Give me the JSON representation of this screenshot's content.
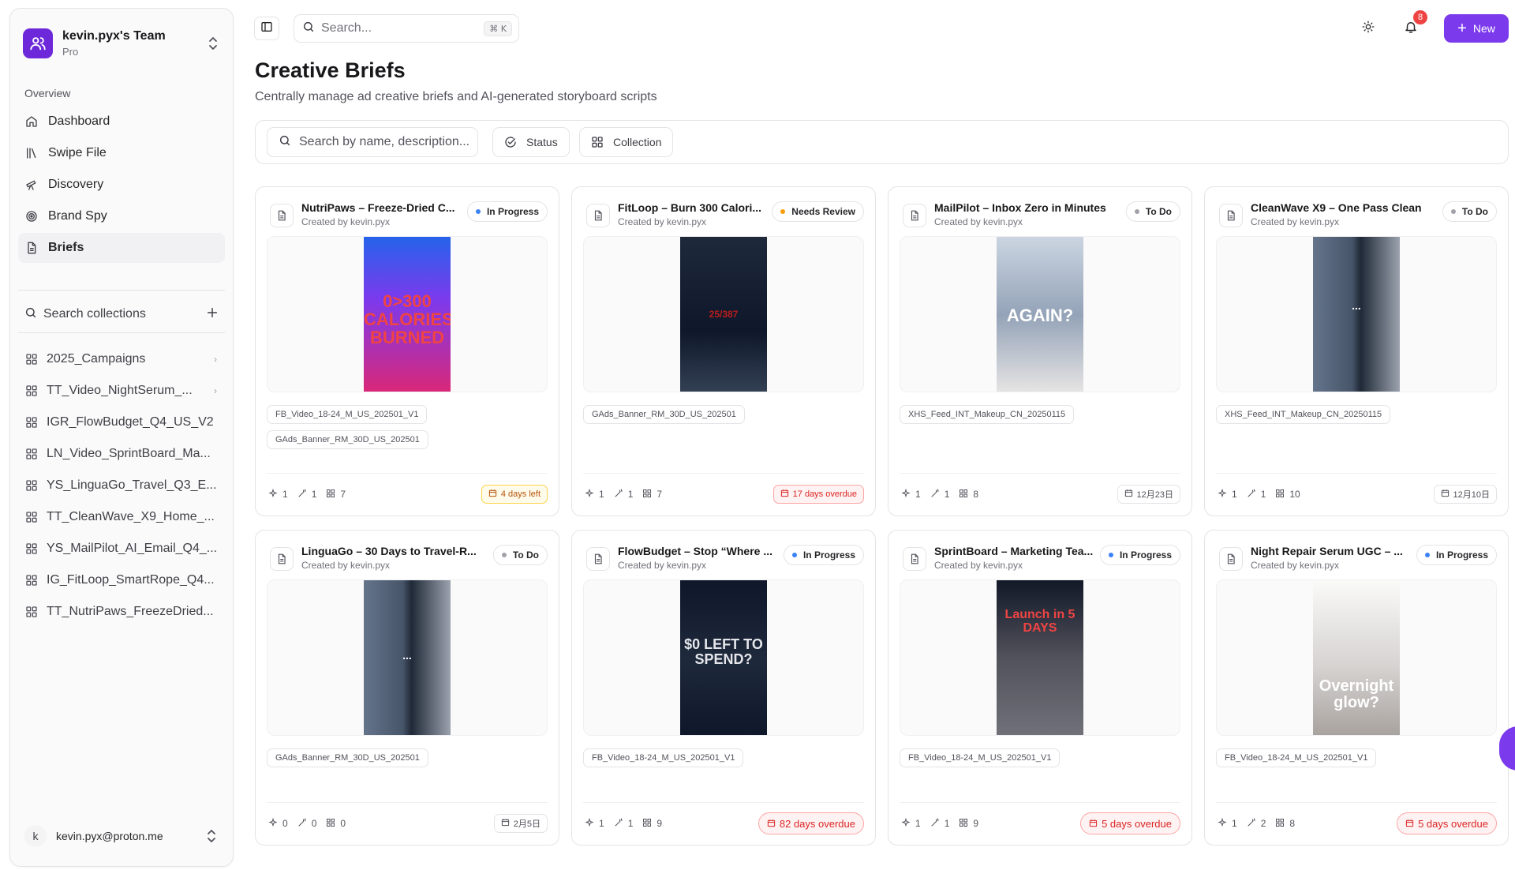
{
  "team": {
    "name": "kevin.pyx's Team",
    "plan": "Pro"
  },
  "nav": {
    "section": "Overview",
    "items": [
      {
        "label": "Dashboard",
        "icon": "home-icon"
      },
      {
        "label": "Swipe File",
        "icon": "library-icon"
      },
      {
        "label": "Discovery",
        "icon": "telescope-icon"
      },
      {
        "label": "Brand Spy",
        "icon": "target-icon"
      },
      {
        "label": "Briefs",
        "icon": "document-icon",
        "active": true
      }
    ]
  },
  "collections": {
    "search_label": "Search collections",
    "items": [
      {
        "label": "2025_Campaigns",
        "chevron": true
      },
      {
        "label": "TT_Video_NightSerum_...",
        "chevron": true
      },
      {
        "label": "IGR_FlowBudget_Q4_US_V2"
      },
      {
        "label": "LN_Video_SprintBoard_Ma..."
      },
      {
        "label": "YS_LinguaGo_Travel_Q3_E..."
      },
      {
        "label": "TT_CleanWave_X9_Home_..."
      },
      {
        "label": "YS_MailPilot_AI_Email_Q4_..."
      },
      {
        "label": "IG_FitLoop_SmartRope_Q4..."
      },
      {
        "label": "TT_NutriPaws_FreezeDried..."
      }
    ]
  },
  "user": {
    "initial": "k",
    "email": "kevin.pyx@proton.me"
  },
  "topbar": {
    "search_placeholder": "Search...",
    "shortcut": "⌘ K",
    "notifications": "8",
    "new_label": "New"
  },
  "page": {
    "title": "Creative Briefs",
    "subtitle": "Centrally manage ad creative briefs and AI-generated storyboard scripts"
  },
  "filters": {
    "search_placeholder": "Search by name, description...",
    "status_label": "Status",
    "collection_label": "Collection"
  },
  "colors": {
    "accent": "#7c3aed",
    "in_progress": "#3b82f6",
    "needs_review": "#f59e0b",
    "todo": "#a1a1aa",
    "overdue": "#dc2626"
  },
  "cards": [
    {
      "title": "NutriPaws – Freeze-Dried C...",
      "by": "Created by kevin.pyx",
      "status": "In Progress",
      "status_color": "#3b82f6",
      "thumb_text": "0>300 CALORIES BURNED",
      "tags": [
        "FB_Video_18-24_M_US_202501_V1",
        "GAds_Banner_RM_30D_US_202501"
      ],
      "s1": "1",
      "s2": "1",
      "s3": "7",
      "due": "4 days left",
      "due_kind": "warn"
    },
    {
      "title": "FitLoop – Burn 300 Calori...",
      "by": "Created by kevin.pyx",
      "status": "Needs Review",
      "status_color": "#f59e0b",
      "thumb_text": "25/387",
      "tags": [
        "GAds_Banner_RM_30D_US_202501"
      ],
      "s1": "1",
      "s2": "1",
      "s3": "7",
      "due": "17 days overdue",
      "due_kind": "over"
    },
    {
      "title": "MailPilot – Inbox Zero in Minutes",
      "by": "Created by kevin.pyx",
      "status": "To Do",
      "status_color": "#a1a1aa",
      "thumb_text": "AGAIN?",
      "tags": [
        "XHS_Feed_INT_Makeup_CN_20250115"
      ],
      "s1": "1",
      "s2": "1",
      "s3": "8",
      "due": "12月23日",
      "due_kind": "plain"
    },
    {
      "title": "CleanWave X9 – One Pass Clean",
      "by": "Created by kevin.pyx",
      "status": "To Do",
      "status_color": "#a1a1aa",
      "thumb_text": "...",
      "tags": [
        "XHS_Feed_INT_Makeup_CN_20250115"
      ],
      "s1": "1",
      "s2": "1",
      "s3": "10",
      "due": "12月10日",
      "due_kind": "plain"
    },
    {
      "title": "LinguaGo – 30 Days to Travel-R...",
      "by": "Created by kevin.pyx",
      "status": "To Do",
      "status_color": "#a1a1aa",
      "thumb_text": "...",
      "tags": [
        "GAds_Banner_RM_30D_US_202501"
      ],
      "s1": "0",
      "s2": "0",
      "s3": "0",
      "due": "2月5日",
      "due_kind": "plain"
    },
    {
      "title": "FlowBudget – Stop “Where ...",
      "by": "Created by kevin.pyx",
      "status": "In Progress",
      "status_color": "#3b82f6",
      "thumb_text": "$0 LEFT TO SPEND?",
      "tags": [
        "FB_Video_18-24_M_US_202501_V1"
      ],
      "s1": "1",
      "s2": "1",
      "s3": "9",
      "due": "82 days overdue",
      "due_kind": "over"
    },
    {
      "title": "SprintBoard – Marketing Tea...",
      "by": "Created by kevin.pyx",
      "status": "In Progress",
      "status_color": "#3b82f6",
      "thumb_text": "Launch in 5 DAYS",
      "tags": [
        "FB_Video_18-24_M_US_202501_V1"
      ],
      "s1": "1",
      "s2": "1",
      "s3": "9",
      "due": "5 days overdue",
      "due_kind": "over"
    },
    {
      "title": "Night Repair Serum UGC – ...",
      "by": "Created by kevin.pyx",
      "status": "In Progress",
      "status_color": "#3b82f6",
      "thumb_text": "Overnight glow?",
      "tags": [
        "FB_Video_18-24_M_US_202501_V1"
      ],
      "s1": "1",
      "s2": "2",
      "s3": "8",
      "due": "5 days overdue",
      "due_kind": "over"
    }
  ]
}
